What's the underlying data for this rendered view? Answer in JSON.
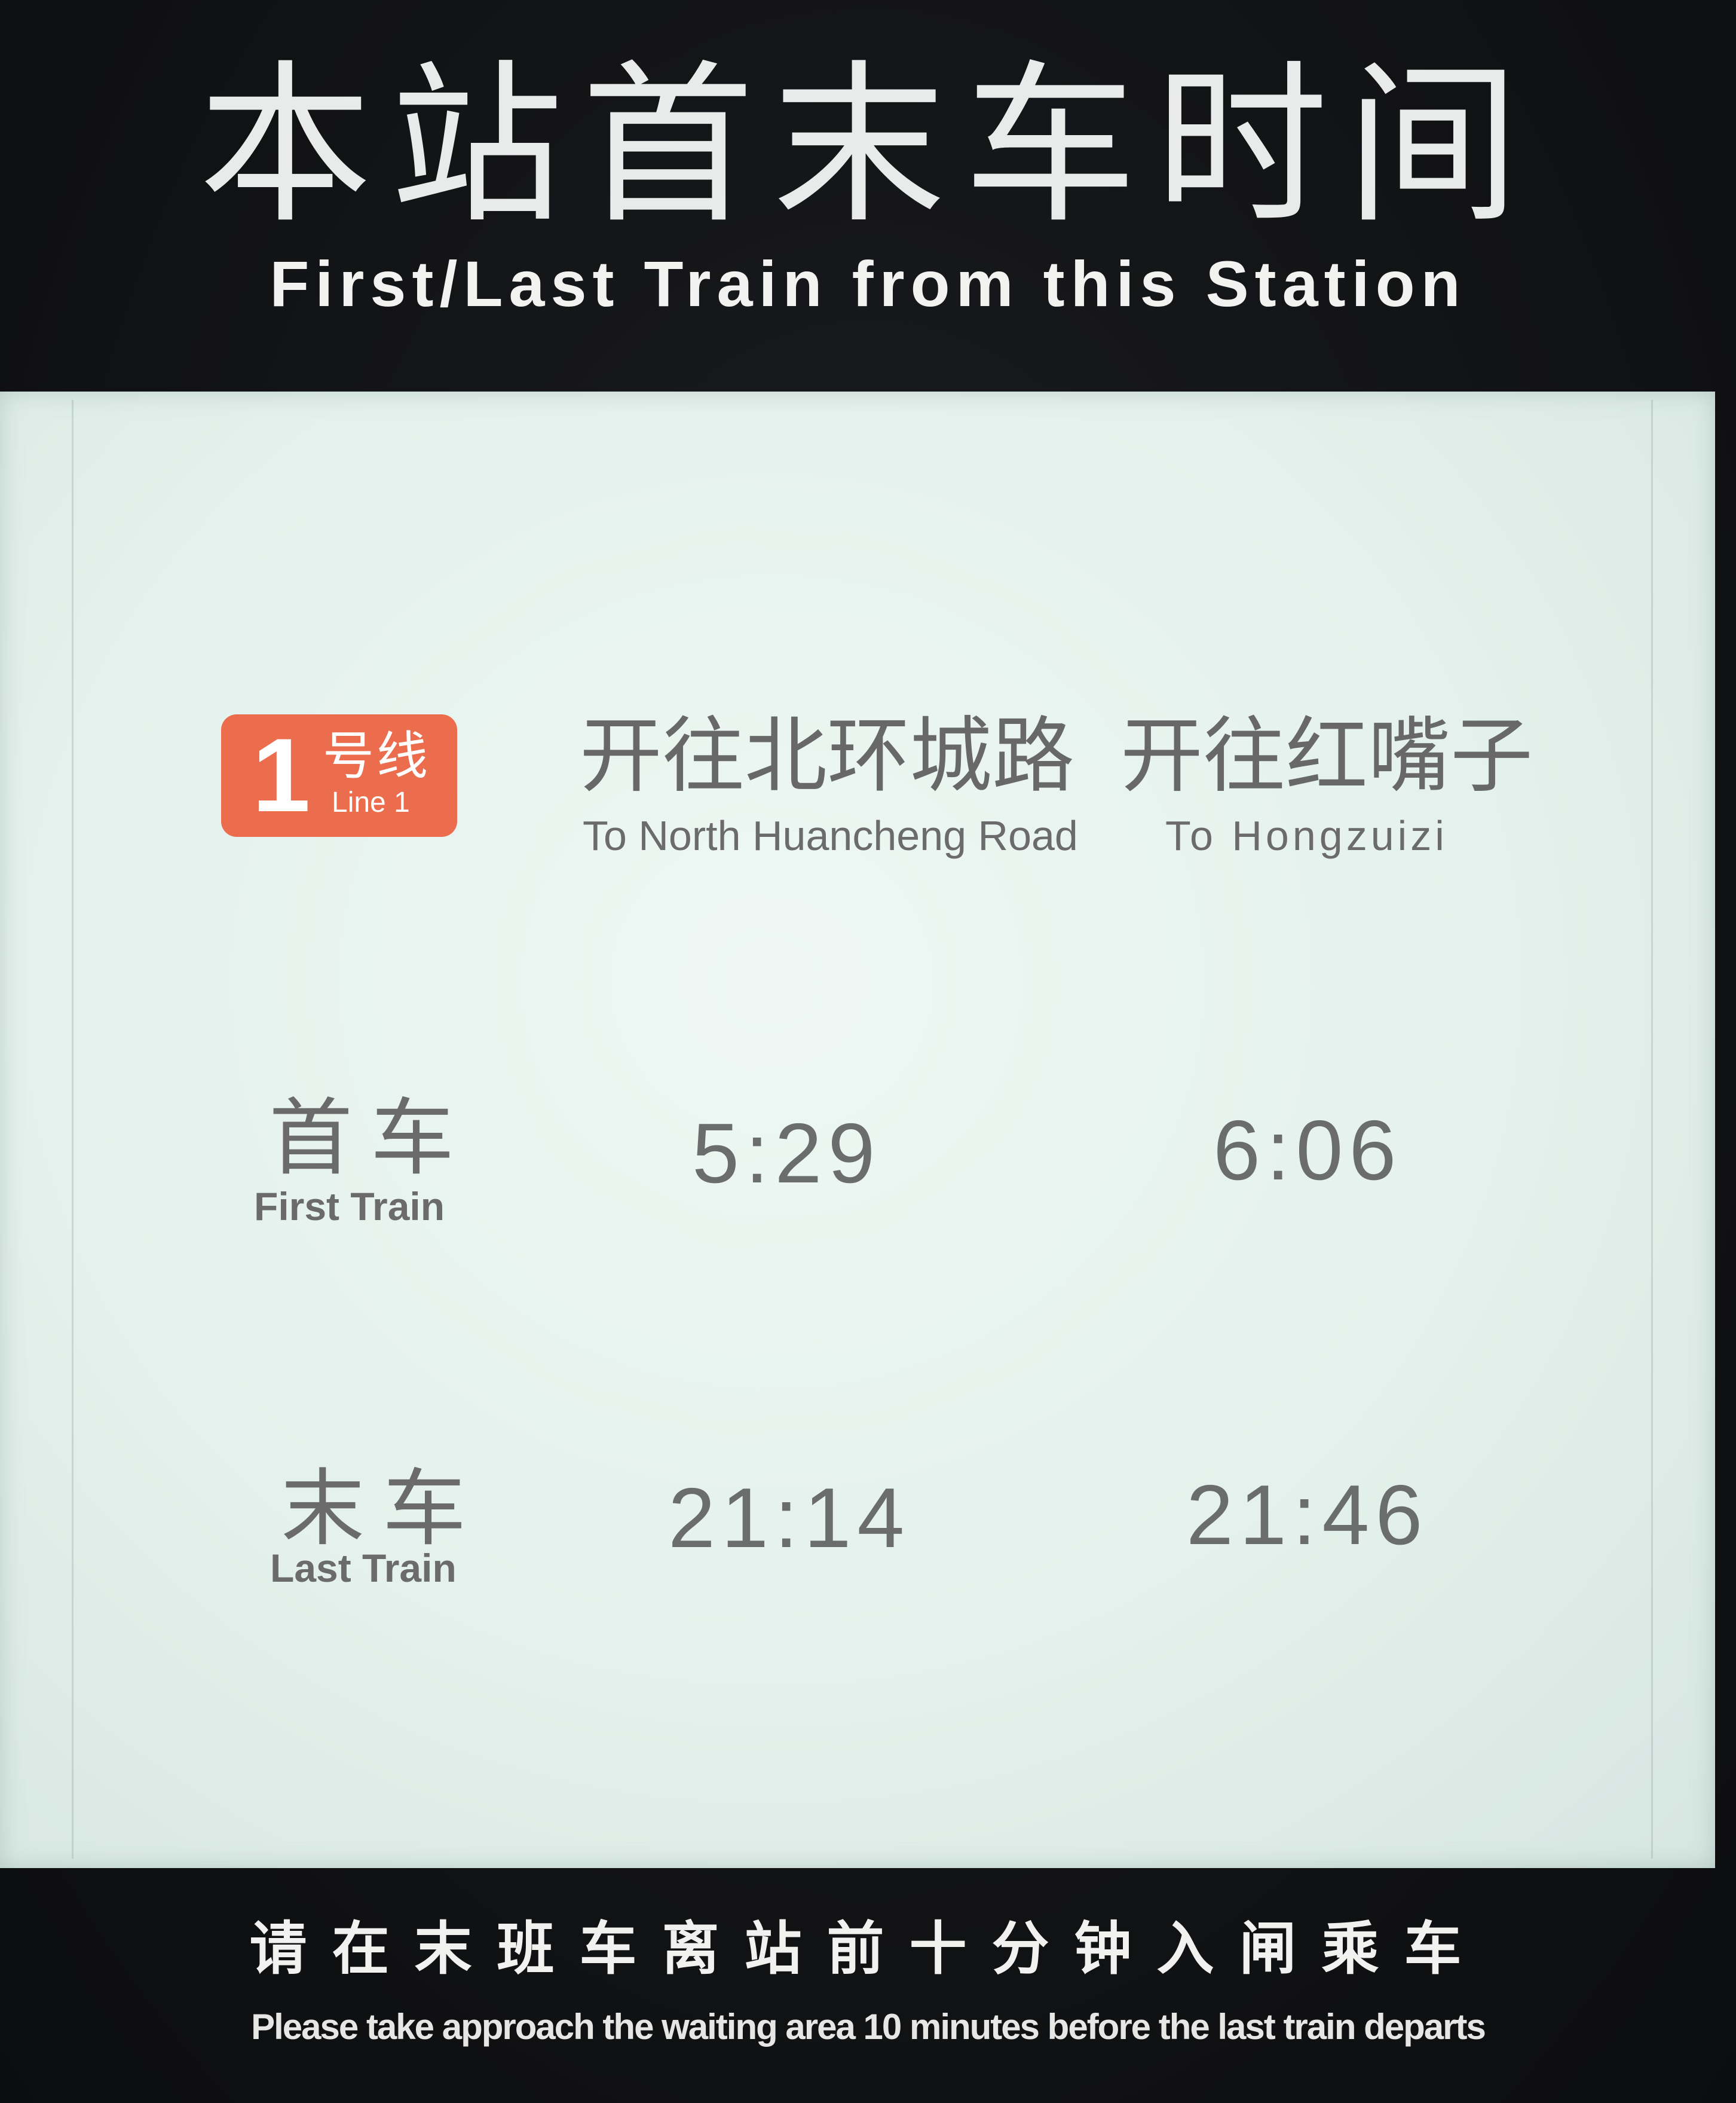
{
  "header": {
    "title_cn": "本站首末车时间",
    "title_en": "First/Last Train from this Station"
  },
  "line": {
    "number": "1",
    "label_cn": "号线",
    "label_en": "Line 1",
    "color": "#ec6d4e"
  },
  "destinations": [
    {
      "cn": "开往北环城路",
      "en": "To North Huancheng Road"
    },
    {
      "cn": "开往红嘴子",
      "en": "To Hongzuizi"
    }
  ],
  "rows": [
    {
      "label_cn": "首车",
      "label_en": "First Train",
      "times": [
        "5:29",
        "6:06"
      ]
    },
    {
      "label_cn": "末车",
      "label_en": "Last Train",
      "times": [
        "21:14",
        "21:46"
      ]
    }
  ],
  "footer": {
    "notice_cn": "请在末班车离站前十分钟入闸乘车",
    "notice_en": "Please take approach the waiting area 10 minutes before the last train departs"
  }
}
